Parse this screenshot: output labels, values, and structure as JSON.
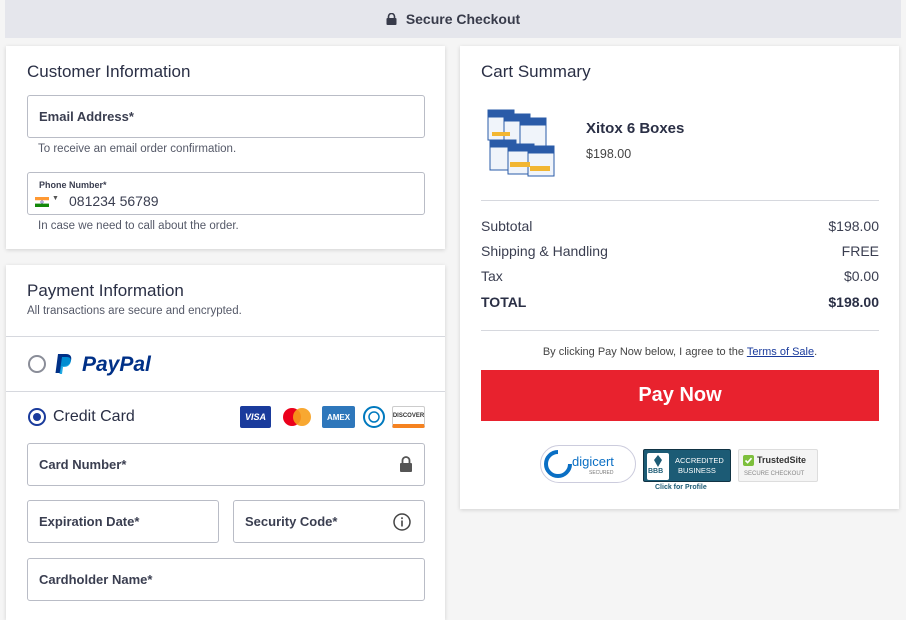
{
  "header": {
    "title": "Secure Checkout"
  },
  "customer": {
    "title": "Customer Information",
    "email_label": "Email Address*",
    "email_hint": "To receive an email order confirmation.",
    "phone_label": "Phone Number*",
    "phone_value": "081234 56789",
    "phone_hint": "In case we need to call about the order."
  },
  "payment": {
    "title": "Payment Information",
    "subtitle": "All transactions are secure and encrypted.",
    "paypal_label": "PayPal",
    "credit_label": "Credit Card",
    "cards": [
      "VISA",
      "AMEX",
      "DISCOVER"
    ],
    "card_number_label": "Card Number*",
    "expiration_label": "Expiration Date*",
    "security_label": "Security Code*",
    "cardholder_label": "Cardholder Name*"
  },
  "cart": {
    "title": "Cart Summary",
    "product_name": "Xitox 6 Boxes",
    "product_price": "$198.00",
    "subtotal_label": "Subtotal",
    "subtotal_value": "$198.00",
    "shipping_label": "Shipping & Handling",
    "shipping_value": "FREE",
    "tax_label": "Tax",
    "tax_value": "$0.00",
    "total_label": "TOTAL",
    "total_value": "$198.00",
    "terms_prefix": "By clicking Pay Now below, I agree to the ",
    "terms_link": "Terms of Sale",
    "terms_suffix": ".",
    "pay_button": "Pay Now"
  },
  "badges": {
    "digicert": "digicert",
    "digicert_sub": "SECURED",
    "bbb_line1": "ACCREDITED",
    "bbb_line2": "BUSINESS",
    "bbb_bbb": "BBB",
    "bbb_profile": "Click for Profile",
    "trustedsite": "TrustedSite",
    "trustedsite_sub": "SECURE CHECKOUT"
  },
  "colors": {
    "accent": "#1a3b9c",
    "pay_button": "#e8222e",
    "paypal_dark": "#003087",
    "paypal_light": "#009cde",
    "bbb_teal": "#1c5b75"
  }
}
